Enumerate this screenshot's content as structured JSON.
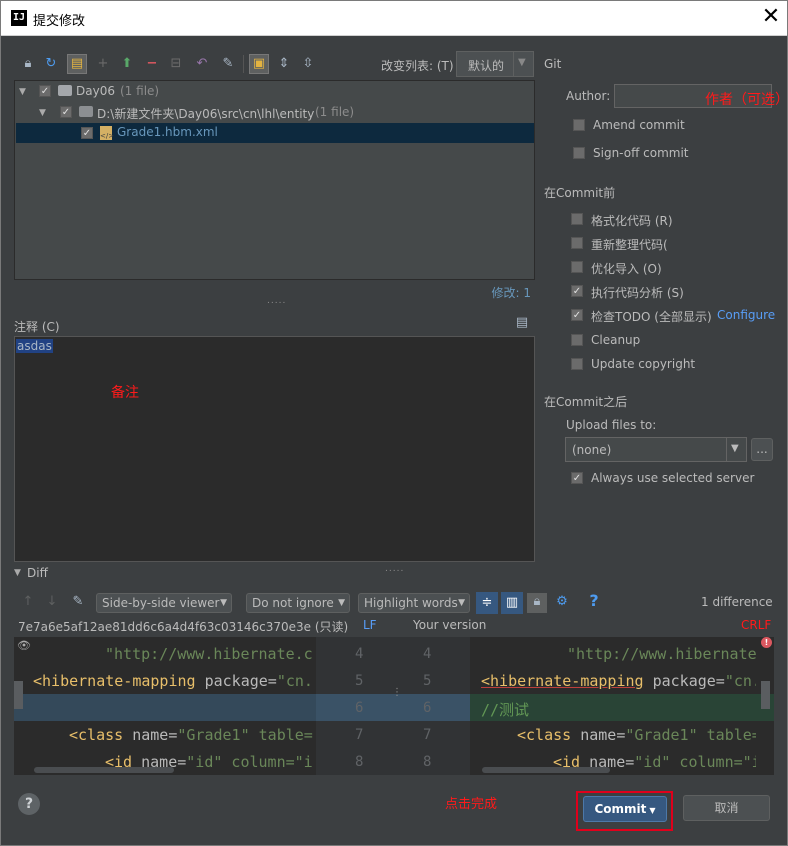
{
  "window": {
    "title": "提交修改",
    "app_icon_letters": "IJ",
    "close_glyph": "✕"
  },
  "changes": {
    "changelist_label": "改变列表: (T)",
    "changelist_value": "默认的",
    "tree": [
      {
        "label": "Day06",
        "count": "(1 file)"
      },
      {
        "label": "D:\\新建文件夹\\Day06\\src\\cn\\lhl\\entity",
        "count": "(1 file)"
      },
      {
        "label": "Grade1.hbm.xml",
        "count": ""
      }
    ],
    "modified": "修改: 1"
  },
  "comment": {
    "label": "注释 (C)",
    "text": "asdas",
    "annotation": "备注"
  },
  "git": {
    "section": "Git",
    "author_label": "Author:",
    "author_annotation": "作者（可选）",
    "amend": "Amend commit",
    "signoff": "Sign-off commit"
  },
  "before_commit": {
    "section": "在Commit前",
    "items": [
      {
        "label": "格式化代码 (R)",
        "checked": false
      },
      {
        "label": "重新整理代码(",
        "checked": false
      },
      {
        "label": "优化导入 (O)",
        "checked": false
      },
      {
        "label": "执行代码分析 (S)",
        "checked": true
      },
      {
        "label": "检查TODO (全部显示)",
        "checked": true
      },
      {
        "label": "Cleanup",
        "checked": false
      },
      {
        "label": "Update copyright",
        "checked": false
      }
    ],
    "configure": "Configure"
  },
  "after_commit": {
    "section": "在Commit之后",
    "upload_label": "Upload files to:",
    "upload_value": "(none)",
    "more": "...",
    "always": "Always use selected server"
  },
  "diff": {
    "title": "Diff",
    "viewer": "Side-by-side viewer",
    "ignore": "Do not ignore",
    "highlight": "Highlight words",
    "count": "1 difference",
    "left_header": "7e7a6e5af12ae81dd6c6a4d4f63c03146c370e3e (只读)",
    "lf": "LF",
    "right_header": "Your version",
    "crlf": "CRLF",
    "left_numbers": [
      "4",
      "5",
      "6",
      "7",
      "8"
    ],
    "right_numbers": [
      "4",
      "5",
      "6",
      "7",
      "8"
    ],
    "left_lines": [
      {
        "a": "",
        "b": "\"http://www.hibernate.c",
        "c": ""
      },
      {
        "a": "<hibernate-mapping",
        "b": " package=",
        "c": "\"cn."
      },
      {
        "a": "",
        "b": "",
        "c": ""
      },
      {
        "a": "<class",
        "b": " name=",
        "c": "\"Grade1\" table="
      },
      {
        "a": "<id",
        "b": " name=",
        "c": "\"id\" column=\"i"
      }
    ],
    "right_lines": [
      {
        "a": "",
        "b": "\"http://www.hibernate.c",
        "c": ""
      },
      {
        "a": "<hibernate-mapping",
        "b": " package=",
        "c": "\"cn."
      },
      {
        "a": "//测试",
        "b": "",
        "c": ""
      },
      {
        "a": "<class",
        "b": " name=",
        "c": "\"Grade1\" table="
      },
      {
        "a": "<id",
        "b": " name=",
        "c": "\"id\" column=\"i"
      }
    ]
  },
  "footer": {
    "help": "?",
    "annotation": "点击完成",
    "commit": "Commit",
    "cancel": "取消"
  },
  "colors": {
    "accent": "#365880",
    "annotation": "#ff1a1a",
    "highlight_box": "#e0001b"
  }
}
